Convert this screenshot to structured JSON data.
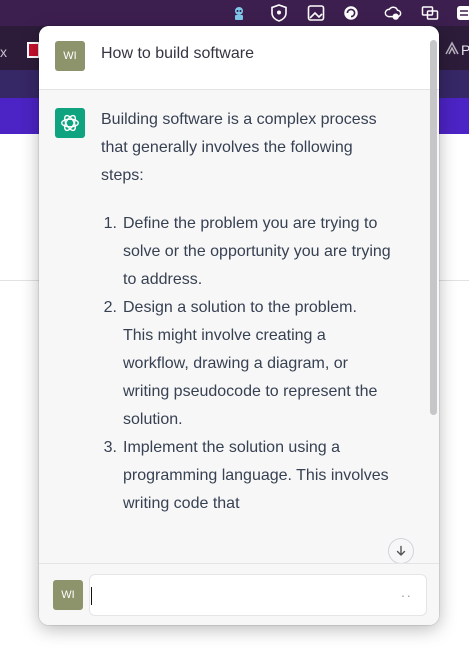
{
  "conversation": {
    "user_avatar": "WI",
    "question": "How to build software",
    "answer": {
      "intro": "Building software is a complex process that generally involves the following steps:",
      "steps": [
        {
          "num": "1.",
          "text": "Define the problem you are trying to solve or the opportunity you are trying to address."
        },
        {
          "num": "2.",
          "text": "Design a solution to the problem. This might involve creating a workflow, drawing a diagram, or writing pseudocode to represent the solution."
        },
        {
          "num": "3.",
          "text": "Implement the solution using a programming language. This involves writing code that"
        }
      ]
    }
  },
  "input": {
    "avatar": "WI",
    "value": "",
    "send_glyph": "··"
  },
  "background": {
    "tab_close": "x",
    "tab_right_letter": "P"
  },
  "menubar_icons": [
    "bot-icon",
    "shield-icon",
    "image-icon",
    "refresh-icon",
    "cloud-icon",
    "mirror-icon",
    "sync-icon"
  ],
  "colors": {
    "gpt_brand": "#10a37f",
    "user_avatar": "#8d946b",
    "header_purple": "#4c23c4"
  }
}
